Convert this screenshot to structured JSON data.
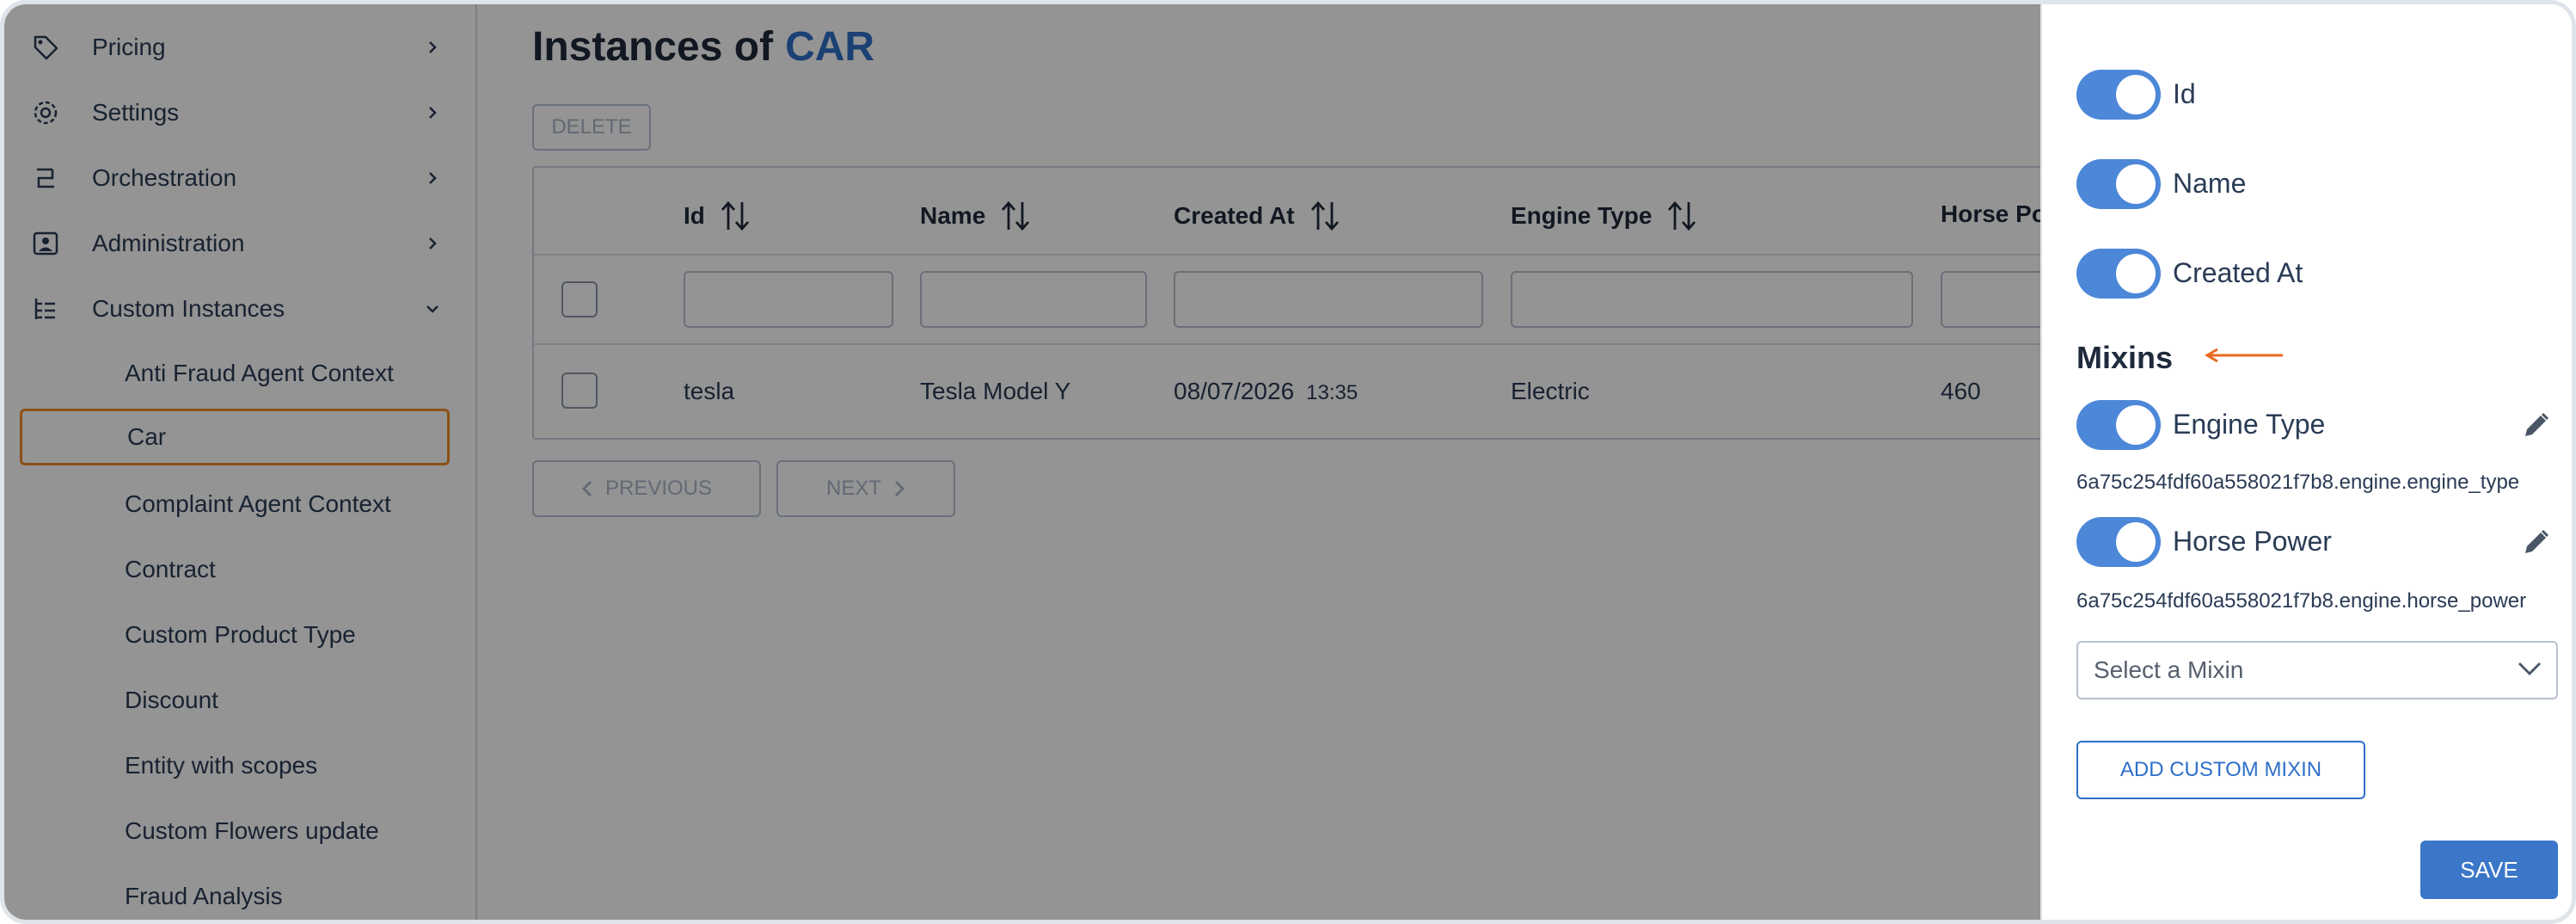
{
  "sidebar": {
    "items": [
      {
        "label": "Pricing",
        "icon": "tag-icon"
      },
      {
        "label": "Settings",
        "icon": "gear-icon"
      },
      {
        "label": "Orchestration",
        "icon": "orchestration-icon"
      },
      {
        "label": "Administration",
        "icon": "admin-icon"
      },
      {
        "label": "Custom Instances",
        "icon": "list-tree-icon"
      }
    ],
    "sub_items": [
      "Anti Fraud Agent Context",
      "Car",
      "Complaint Agent Context",
      "Contract",
      "Custom Product Type",
      "Discount",
      "Entity with scopes",
      "Custom Flowers update",
      "Fraud Analysis"
    ],
    "active_sub_item": "Car"
  },
  "main": {
    "title_prefix": "Instances of",
    "title_entity": "CAR",
    "delete_label": "DELETE",
    "table": {
      "columns": [
        "Id",
        "Name",
        "Created At",
        "Engine Type",
        "Horse Pow"
      ],
      "rows": [
        {
          "id": "tesla",
          "name": "Tesla Model Y",
          "created_date": "08/07/2026",
          "created_time": "13:35",
          "engine_type": "Electric",
          "horse_power": "460"
        }
      ]
    },
    "previous_label": "PREVIOUS",
    "next_label": "NEXT"
  },
  "panel": {
    "fields": [
      {
        "label": "Id",
        "enabled": true
      },
      {
        "label": "Name",
        "enabled": true
      },
      {
        "label": "Created At",
        "enabled": true
      }
    ],
    "mixins_heading": "Mixins",
    "mixins": [
      {
        "label": "Engine Type",
        "path": "6a75c254fdf60a558021f7b8.engine.engine_type",
        "enabled": true
      },
      {
        "label": "Horse Power",
        "path": "6a75c254fdf60a558021f7b8.engine.horse_power",
        "enabled": true
      }
    ],
    "select_placeholder": "Select a Mixin",
    "add_custom_label": "ADD CUSTOM MIXIN",
    "save_label": "SAVE"
  },
  "colors": {
    "accent": "#3b76c8",
    "toggle_on": "#4c87d8",
    "highlight": "#f08a24",
    "arrow": "#e8691f"
  }
}
